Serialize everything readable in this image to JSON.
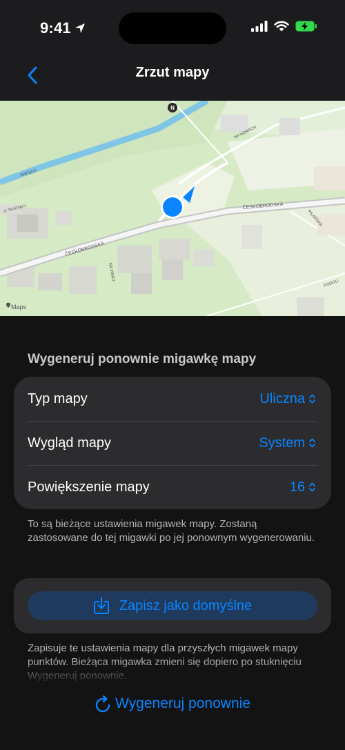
{
  "status": {
    "time": "9:41"
  },
  "nav": {
    "title": "Zrzut mapy"
  },
  "map": {
    "attribution": "Maps",
    "street_labels": [
      "ČESKOBRODSKÁ",
      "ČESKOBRODSKÁ",
      "U TRATNKY",
      "NA HORÁCH",
      "PILAŘSKÁ",
      "NA VINICI",
      "RAPSKÁ",
      "PODOLÍ"
    ],
    "compass": "N"
  },
  "settings": {
    "header": "Wygeneruj ponownie migawkę mapy",
    "rows": [
      {
        "label": "Typ mapy",
        "value": "Uliczna"
      },
      {
        "label": "Wygląd mapy",
        "value": "System"
      },
      {
        "label": "Powiększenie mapy",
        "value": "16"
      }
    ],
    "footnote": "To są bieżące ustawienia migawek mapy. Zostaną zastosowane do tej migawki po jej ponownym wygenerowaniu."
  },
  "save": {
    "label": "Zapisz jako domyślne",
    "footnote": "Zapisuje te ustawienia mapy dla przyszłych migawek mapy punktów. Bieżąca migawka zmieni się dopiero po stuknięciu Wygeneruj ponownie."
  },
  "regenerate": {
    "label": "Wygeneruj ponownie"
  },
  "colors": {
    "accent": "#0a84ff",
    "background": "#131313",
    "cell": "#2c2c2e",
    "battery": "#32d74b"
  }
}
